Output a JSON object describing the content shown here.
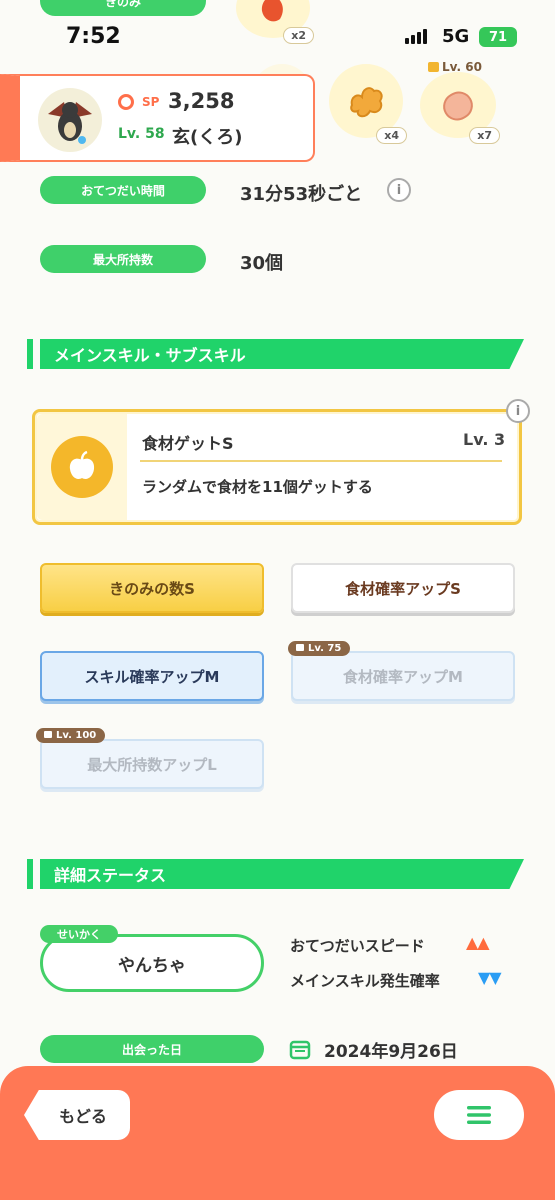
{
  "status_bar": {
    "time": "7:52",
    "network": "5G",
    "battery": "71"
  },
  "top_strip": {
    "label": "きのみ",
    "items": [
      {
        "icon": "berry-icon",
        "qty": "x2"
      },
      {
        "icon": "ginger-icon",
        "qty": "x4"
      },
      {
        "icon": "sausage-icon",
        "qty": "x7",
        "lock_level": "Lv. 60"
      }
    ]
  },
  "pokemon": {
    "sp_label": "SP",
    "sp_value": "3,258",
    "level": "Lv. 58",
    "name": "玄(くろ)"
  },
  "rows": [
    {
      "label": "おてつだい時間",
      "value": "31分53秒ごと"
    },
    {
      "label": "最大所持数",
      "value": "30個"
    }
  ],
  "sections": {
    "skills_title": "メインスキル・サブスキル",
    "details_title": "詳細ステータス"
  },
  "main_skill": {
    "name": "食材ゲットS",
    "level": "Lv. 3",
    "description": "ランダムで食材を11個ゲットする"
  },
  "sub_skills": [
    {
      "label": "きのみの数S",
      "style": "yellow",
      "lock": ""
    },
    {
      "label": "食材確率アップS",
      "style": "white",
      "lock": ""
    },
    {
      "label": "スキル確率アップM",
      "style": "blue",
      "lock": ""
    },
    {
      "label": "食材確率アップM",
      "style": "locked",
      "lock": "Lv. 75"
    },
    {
      "label": "最大所持数アップL",
      "style": "locked",
      "lock": "Lv. 100"
    }
  ],
  "nature": {
    "tag": "せいかく",
    "value": "やんちゃ",
    "effects": [
      {
        "label": "おてつだいスピード",
        "marks": "▲▲",
        "color": "#ff6b3d"
      },
      {
        "label": "メインスキル発生確率",
        "marks": "▼▼",
        "color": "#2a9df4"
      }
    ]
  },
  "met_date": {
    "label": "出会った日",
    "value": "2024年9月26日"
  },
  "bottom_nav": {
    "back_label": "もどる"
  },
  "colors": {
    "accent_green": "#20d36a",
    "accent_orange": "#ff7855",
    "skill_yellow": "#f2c643"
  }
}
